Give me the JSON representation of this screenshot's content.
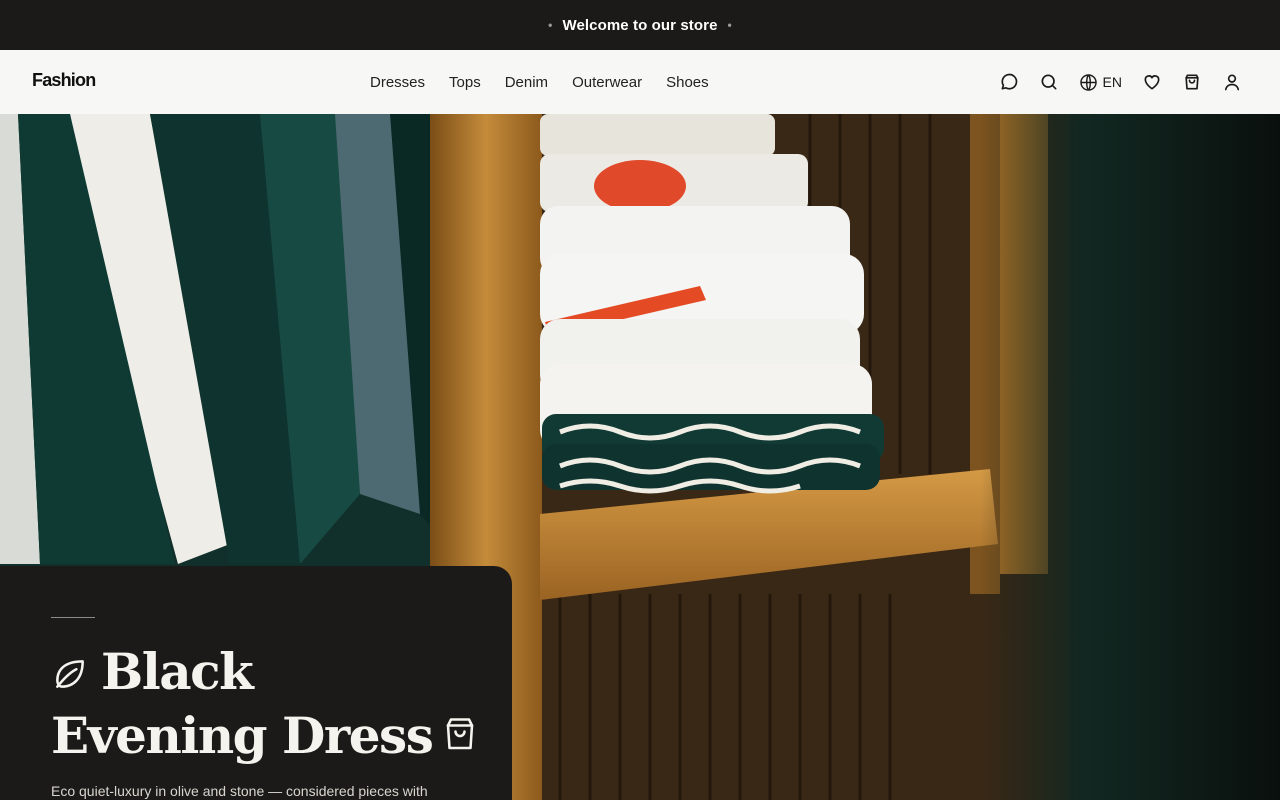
{
  "announcement": {
    "text": "Welcome to our store"
  },
  "header": {
    "logo": "Fashion",
    "nav": [
      "Dresses",
      "Tops",
      "Denim",
      "Outerwear",
      "Shoes"
    ],
    "language": "EN"
  },
  "icons": {
    "chat": "chat-bubble-icon",
    "search": "search-icon",
    "language": "globe-icon",
    "wishlist": "heart-icon",
    "cart": "shopping-bag-icon",
    "account": "user-icon"
  },
  "hero": {
    "title_line1": "Black",
    "title_line2": "Evening Dress",
    "description": "Eco quiet-luxury in olive and stone — considered pieces with"
  },
  "colors": {
    "dark": "#1b1a18",
    "header_bg": "#f7f7f5",
    "wood": "#b07a2c"
  }
}
